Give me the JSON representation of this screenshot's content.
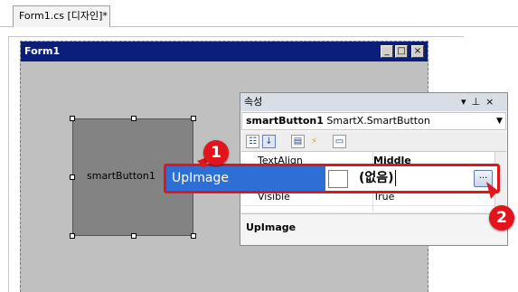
{
  "document_tab": {
    "label": "Form1.cs [디자인]*"
  },
  "form": {
    "title": "Form1",
    "caption_buttons": [
      "_",
      "□",
      "×"
    ]
  },
  "smart_button": {
    "text": "smartButton1"
  },
  "properties": {
    "title": "속성",
    "title_icons": [
      "▾",
      "⊥",
      "×"
    ],
    "object_name": "smartButton1",
    "object_type": "SmartX.SmartButton",
    "toolbar_icons": [
      "categorized-icon",
      "alphabetical-icon",
      "properties-icon",
      "events-icon",
      "property-pages-icon"
    ],
    "rows": [
      {
        "name": "TextAlign",
        "value": "Middle"
      },
      {
        "name": "Visible",
        "value": "True"
      }
    ],
    "description_title": "UpImage"
  },
  "highlight": {
    "name": "UpImage",
    "value": "(없음)",
    "ellipsis": "...",
    "accent_color": "#e3151a",
    "selection_color": "#2e6fd6"
  },
  "steps": [
    "1",
    "2"
  ]
}
